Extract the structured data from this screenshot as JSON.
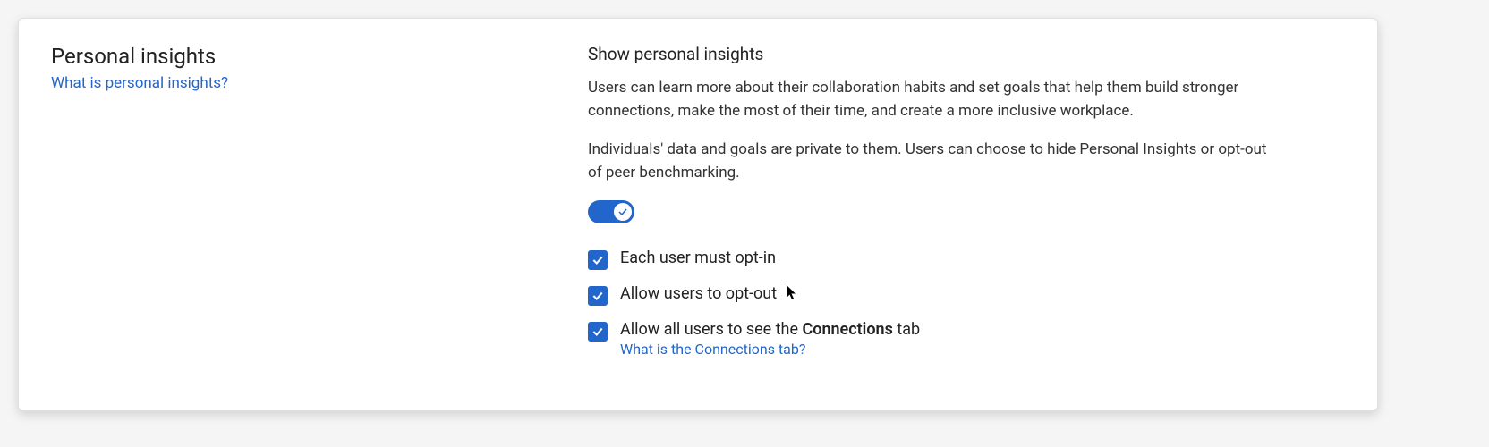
{
  "section": {
    "title": "Personal insights",
    "help_link": "What is personal insights?"
  },
  "settings": {
    "heading": "Show personal insights",
    "description1": "Users can learn more about their collaboration habits and set goals that help them build stronger connections, make the most of their time, and create a more inclusive workplace.",
    "description2": "Individuals' data and goals are private to them. Users can choose to hide Personal Insights or opt-out of peer benchmarking.",
    "toggle_on": true,
    "options": [
      {
        "label_plain": "Each user must opt-in",
        "bold": "",
        "tail": "",
        "sublink": ""
      },
      {
        "label_plain": "Allow users to opt-out",
        "bold": "",
        "tail": "",
        "sublink": "",
        "cursor": true
      },
      {
        "label_plain": "Allow all users to see the ",
        "bold": "Connections",
        "tail": " tab",
        "sublink": "What is the Connections tab?"
      }
    ]
  }
}
